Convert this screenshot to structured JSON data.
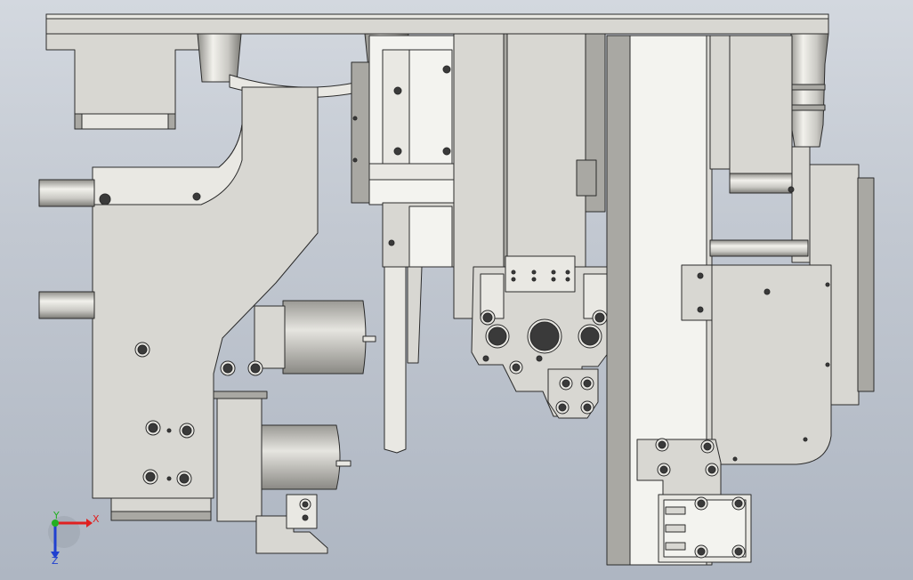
{
  "viewport": {
    "background_top": "#d3d8df",
    "background_bottom": "#aeb6c2"
  },
  "model": {
    "part_fill": "#d8d7d2",
    "part_fill_light": "#e9e8e3",
    "part_fill_dark": "#a9a8a3",
    "edge_color": "#2b2b2b",
    "white_fill": "#f3f3ef"
  },
  "triad": {
    "x_label": "X",
    "y_label": "Y",
    "z_label": "Z",
    "x_color": "#e02020",
    "y_color": "#22b022",
    "z_color": "#2040d0"
  }
}
